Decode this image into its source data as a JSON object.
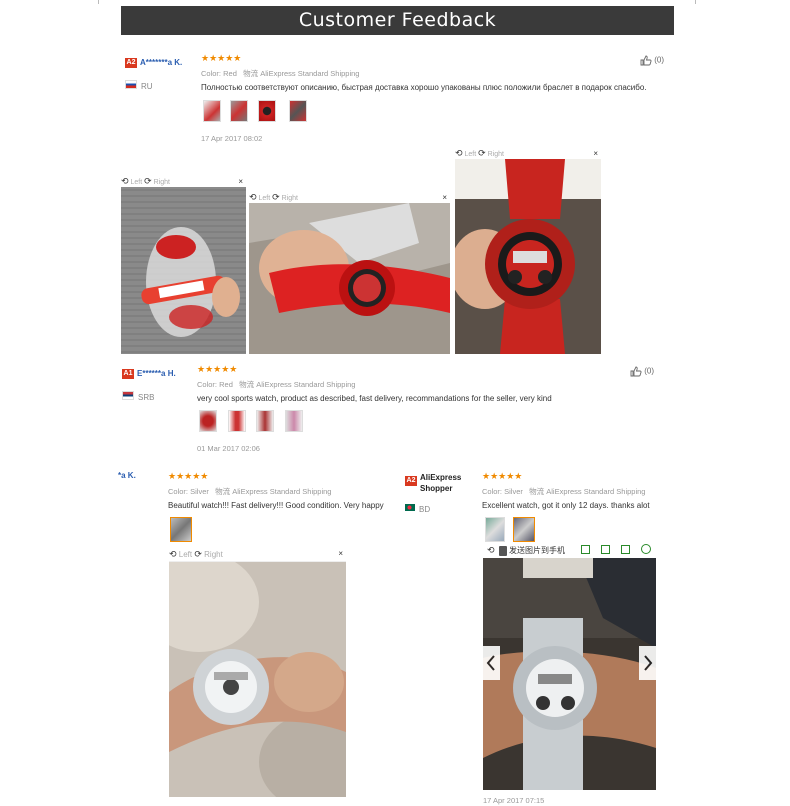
{
  "title": "Customer Feedback",
  "reviews": [
    {
      "level": "A2",
      "name": "A*******a K.",
      "country": "RU",
      "stars": "★★★★★",
      "color_label": "Color:",
      "color_value": "Red",
      "shipping_label": "物流",
      "shipping_value": "AliExpress Standard Shipping",
      "text": "Полностью соответствуют описанию, быстрая доставка хорошо упакованы плюс положили браслет в подарок спасибо.",
      "date": "17 Apr 2017 08:02",
      "likes": "(0)"
    },
    {
      "level": "A1",
      "name": "E******a H.",
      "country": "SRB",
      "stars": "★★★★★",
      "color_label": "Color:",
      "color_value": "Red",
      "shipping_label": "物流",
      "shipping_value": "AliExpress Standard Shipping",
      "text": "very cool sports watch, product as described, fast delivery, recommandations for the seller, very kind",
      "date": "01 Mar 2017 02:06",
      "likes": "(0)"
    },
    {
      "name": "*a K.",
      "stars": "★★★★★",
      "color_label": "Color:",
      "color_value": "Silver",
      "shipping_label": "物流",
      "shipping_value": "AliExpress Standard Shipping",
      "text": "Beautiful watch!!! Fast delivery!!! Good condition. Very happy"
    },
    {
      "level": "A2",
      "name": "AliExpress Shopper",
      "country": "BD",
      "stars": "★★★★★",
      "color_label": "Color:",
      "color_value": "Silver",
      "shipping_label": "物流",
      "shipping_value": "AliExpress Standard Shipping",
      "text": "Excellent watch, got it only 12 days. thanks alot",
      "date": "17 Apr 2017 07:15"
    }
  ],
  "viewer": {
    "left_label": "Left",
    "right_label": "Right",
    "close": "×",
    "send_to_phone": "发送图片到手机"
  },
  "icons": {
    "like": "thumbs-up-icon",
    "rotate_left": "rotate-left-icon",
    "rotate_right": "rotate-right-icon",
    "close": "close-icon",
    "prev": "chevron-left-icon",
    "next": "chevron-right-icon"
  }
}
